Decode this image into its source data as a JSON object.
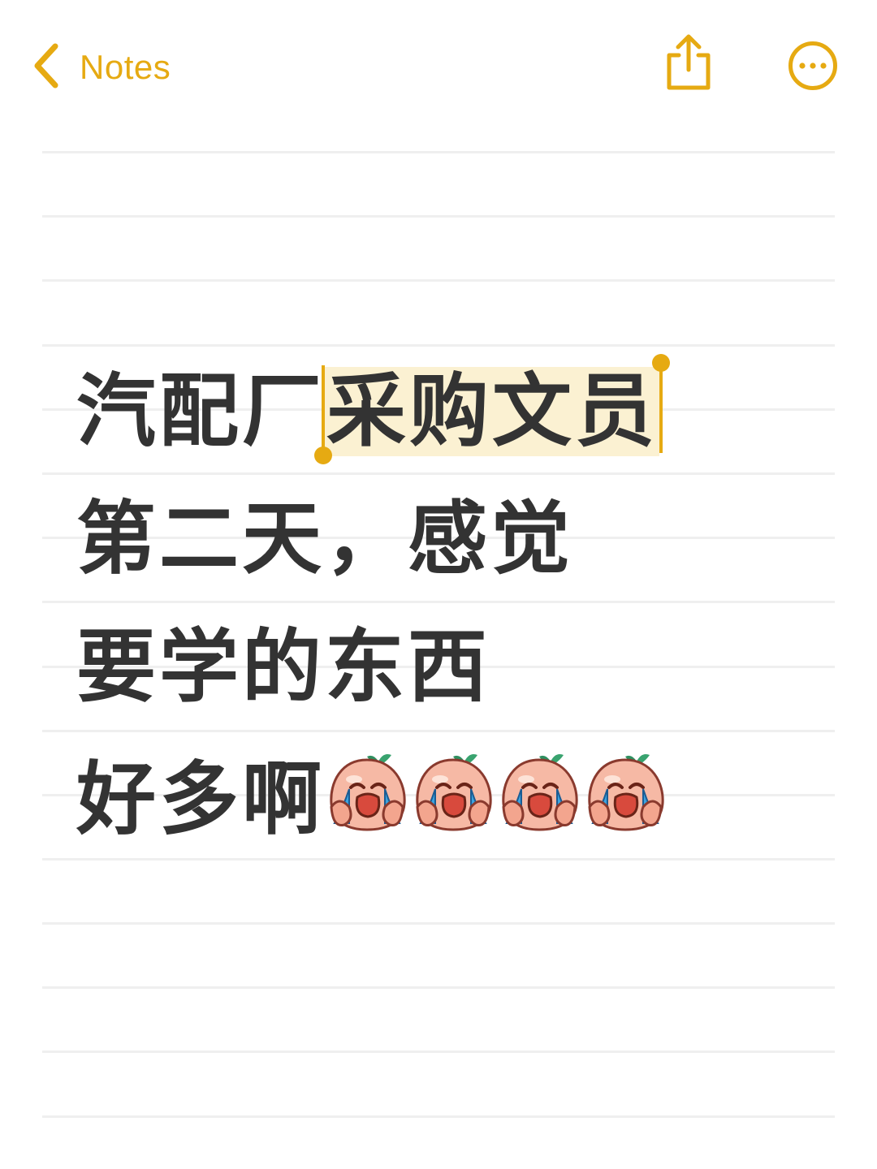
{
  "nav": {
    "back_label": "Notes",
    "back_icon": "chevron-left-icon",
    "share_icon": "share-icon",
    "more_icon": "ellipsis-circle-icon",
    "accent_color": "#e6aa12"
  },
  "note": {
    "line1_before": "汽配厂",
    "line1_selected": "采购文员",
    "line2": "第二天，感觉",
    "line3": "要学的东西",
    "line4_text": "好多啊",
    "line4_emoji": "crying-face-emoji",
    "line4_emoji_count": 4,
    "text_color": "#333333",
    "selection_color": "#fbf1d2"
  }
}
